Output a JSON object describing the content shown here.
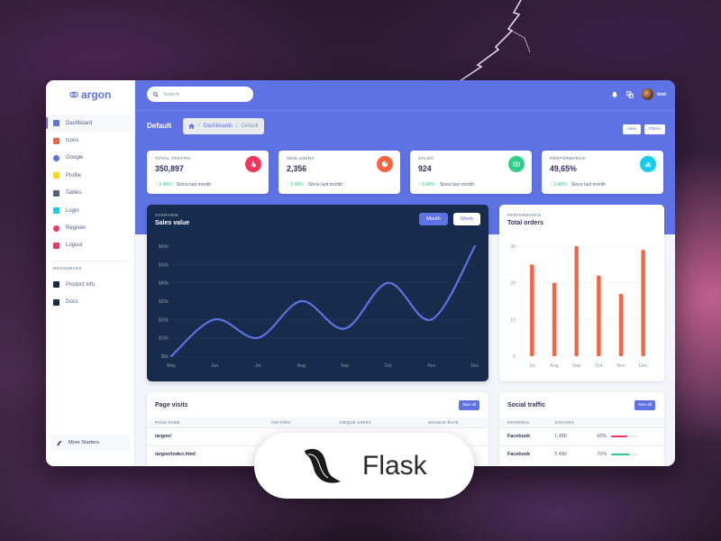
{
  "app": {
    "logo_text": "argon"
  },
  "sidebar": {
    "items": [
      {
        "label": "Dashboard",
        "icon": "monitor-icon",
        "color": "#5e72e4",
        "active": true
      },
      {
        "label": "Icons",
        "icon": "planet-icon",
        "color": "#fb6340"
      },
      {
        "label": "Google",
        "icon": "pin-icon",
        "color": "#5e72e4"
      },
      {
        "label": "Profile",
        "icon": "user-icon",
        "color": "#ffd600"
      },
      {
        "label": "Tables",
        "icon": "bullet-list-icon",
        "color": "#525f7f"
      },
      {
        "label": "Login",
        "icon": "key-icon",
        "color": "#11cdef"
      },
      {
        "label": "Register",
        "icon": "circle-icon",
        "color": "#f5365c"
      },
      {
        "label": "Logout",
        "icon": "user-run-icon",
        "color": "#f5365c"
      }
    ],
    "section_heading": "RESOURCES",
    "resources": [
      {
        "label": "Product info",
        "icon": "spaceship-icon"
      },
      {
        "label": "Docs",
        "icon": "palette-icon"
      }
    ],
    "more_label": "More Starters"
  },
  "topbar": {
    "search_placeholder": "Search",
    "user_name": "test"
  },
  "header": {
    "title": "Default",
    "breadcrumb": [
      "Dashboards",
      "Default"
    ],
    "buttons": [
      "New",
      "Filters"
    ]
  },
  "stats": [
    {
      "label": "TOTAL TRAFFIC",
      "value": "350,897",
      "delta": "3.48%",
      "since": "Since last month",
      "icon": "hand-pointer-icon",
      "color": "#f5365c"
    },
    {
      "label": "NEW USERS",
      "value": "2,356",
      "delta": "3.48%",
      "since": "Since last month",
      "icon": "pie-chart-icon",
      "color": "#fb6340"
    },
    {
      "label": "SALES",
      "value": "924",
      "delta": "3.48%",
      "since": "Since last month",
      "icon": "money-icon",
      "color": "#2dce89"
    },
    {
      "label": "PERFORMANCE",
      "value": "49,65%",
      "delta": "3.48%",
      "since": "Since last month",
      "icon": "bar-chart-icon",
      "color": "#11cdef"
    }
  ],
  "sales_card": {
    "kicker": "OVERVIEW",
    "title": "Sales value",
    "toggle": [
      "Month",
      "Week"
    ]
  },
  "orders_card": {
    "kicker": "PERFORMANCE",
    "title": "Total orders"
  },
  "chart_data": [
    {
      "type": "line",
      "title": "Sales value",
      "x": [
        "May",
        "Jun",
        "Jul",
        "Aug",
        "Sep",
        "Oct",
        "Nov",
        "Dec"
      ],
      "yticks": [
        "$0k",
        "$10k",
        "$20k",
        "$30k",
        "$40k",
        "$50k",
        "$60k"
      ],
      "series": [
        {
          "values": [
            0,
            20,
            10,
            30,
            15,
            40,
            20,
            60
          ]
        }
      ],
      "ylim": [
        0,
        60
      ],
      "grid": true,
      "color": "#5e72e4"
    },
    {
      "type": "bar",
      "title": "Total orders",
      "categories": [
        "Jul",
        "Aug",
        "Sep",
        "Oct",
        "Nov",
        "Dec"
      ],
      "values": [
        25,
        20,
        30,
        22,
        17,
        29
      ],
      "yticks": [
        "0",
        "10",
        "20",
        "30"
      ],
      "ylim": [
        0,
        30
      ],
      "grid": true,
      "color": "#fb6340"
    }
  ],
  "page_visits": {
    "title": "Page visits",
    "see_all": "See all",
    "columns": [
      "PAGE NAME",
      "VISITORS",
      "UNIQUE USERS",
      "BOUNCE RATE"
    ],
    "rows": [
      [
        "/argon/",
        "",
        "",
        ""
      ],
      [
        "/argon/index.html",
        "",
        "",
        ""
      ]
    ]
  },
  "social_traffic": {
    "title": "Social traffic",
    "see_all": "See all",
    "columns": [
      "REFERRAL",
      "VISITORS",
      ""
    ],
    "rows": [
      {
        "name": "Facebook",
        "visitors": "1,480",
        "pct": "60%",
        "fill": 0.6,
        "color": "#f5365c"
      },
      {
        "name": "Facebook",
        "visitors": "5,480",
        "pct": "70%",
        "fill": 0.7,
        "color": "#2dce89"
      }
    ]
  },
  "badge": {
    "text": "Flask"
  }
}
